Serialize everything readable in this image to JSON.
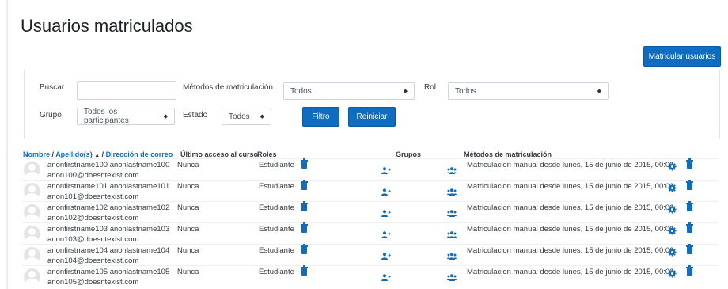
{
  "page": {
    "title": "Usuarios matriculados"
  },
  "actions": {
    "enrol_users": "Matricular usuarios"
  },
  "filters": {
    "search_label": "Buscar",
    "search_value": "",
    "methods_label": "Métodos de matriculación",
    "methods_value": "Todos",
    "role_label": "Rol",
    "role_value": "Todos",
    "group_label": "Grupo",
    "group_value": "Todos los participantes",
    "status_label": "Estado",
    "status_value": "Todos",
    "filter_button": "Filtro",
    "reset_button": "Reiniciar"
  },
  "table": {
    "headers": {
      "name": "Nombre",
      "name_sep": " / ",
      "surname": "Apellido(s)",
      "sort_indicator": "▲",
      "email_sep": " / ",
      "email": "Dirección de correo",
      "last_access": "Último acceso al curso",
      "roles": "Roles",
      "groups": "Grupos",
      "methods": "Métodos de matriculación"
    },
    "rows": [
      {
        "name": "anonfirstname100 anonlastname100",
        "email": "anon100@doesntexist.com",
        "last_access": "Nunca",
        "role": "Estudiante",
        "method": "Matriculacion manual desde lunes, 15 de junio de 2015, 00:00"
      },
      {
        "name": "anonfirstname101 anonlastname101",
        "email": "anon101@doesntexist.com",
        "last_access": "Nunca",
        "role": "Estudiante",
        "method": "Matriculacion manual desde lunes, 15 de junio de 2015, 00:00"
      },
      {
        "name": "anonfirstname102 anonlastname102",
        "email": "anon102@doesntexist.com",
        "last_access": "Nunca",
        "role": "Estudiante",
        "method": "Matriculacion manual desde lunes, 15 de junio de 2015, 00:00"
      },
      {
        "name": "anonfirstname103 anonlastname103",
        "email": "anon103@doesntexist.com",
        "last_access": "Nunca",
        "role": "Estudiante",
        "method": "Matriculacion manual desde lunes, 15 de junio de 2015, 00:00"
      },
      {
        "name": "anonfirstname104 anonlastname104",
        "email": "anon104@doesntexist.com",
        "last_access": "Nunca",
        "role": "Estudiante",
        "method": "Matriculacion manual desde lunes, 15 de junio de 2015, 00:00"
      },
      {
        "name": "anonfirstname105 anonlastname105",
        "email": "anon105@doesntexist.com",
        "last_access": "Nunca",
        "role": "Estudiante",
        "method": "Matriculacion manual desde lunes, 15 de junio de 2015, 00:00"
      }
    ]
  },
  "icons": {
    "trash": "trash-icon",
    "add_group": "user-plus-icon",
    "groups": "users-icon",
    "settings": "gear-icon",
    "avatar": "default-user-avatar"
  },
  "colors": {
    "primary": "#0f6cbf",
    "link": "#0f6cbf"
  }
}
